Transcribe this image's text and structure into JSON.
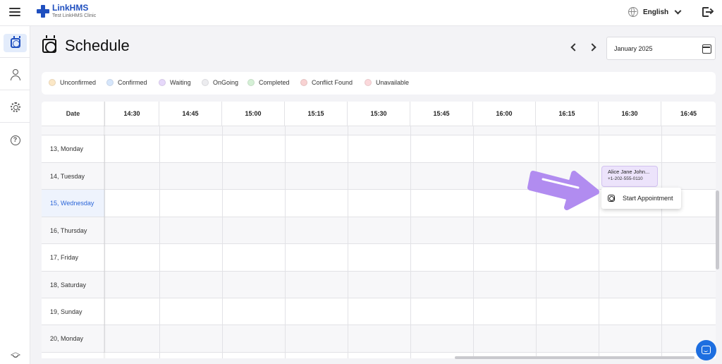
{
  "app": {
    "brand": "LinkHMS",
    "clinic": "Test LinkHMS Clinic",
    "language": "English"
  },
  "sidebar": {
    "items": [
      {
        "name": "sidebar-item-schedule",
        "icon": "schedule-icon",
        "active": true
      },
      {
        "name": "sidebar-item-patients",
        "icon": "user-icon",
        "active": false
      },
      {
        "name": "sidebar-item-settings",
        "icon": "gear-icon",
        "active": false
      },
      {
        "name": "sidebar-item-help",
        "icon": "help-icon",
        "active": false
      },
      {
        "name": "sidebar-item-learning",
        "icon": "graduation-cap-icon",
        "active": false
      }
    ]
  },
  "header": {
    "title": "Schedule",
    "date_value": "January 2025"
  },
  "legend": [
    {
      "label": "Unconfirmed",
      "color": "#fbe7c6"
    },
    {
      "label": "Confirmed",
      "color": "#d6e6fb"
    },
    {
      "label": "Waiting",
      "color": "#e6d8fa"
    },
    {
      "label": "OnGoing",
      "color": "#ececef"
    },
    {
      "label": "Completed",
      "color": "#d5f0d6"
    },
    {
      "label": "Conflict Found",
      "color": "#f8d2d2"
    },
    {
      "label": "Unavailable",
      "color": "#fbd8db"
    }
  ],
  "grid": {
    "date_header": "Date",
    "times": [
      "14:30",
      "14:45",
      "15:00",
      "15:15",
      "15:30",
      "15:45",
      "16:00",
      "16:15",
      "16:30",
      "16:45"
    ],
    "rows": [
      "13, Monday",
      "14, Tuesday",
      "15, Wednesday",
      "16, Thursday",
      "17, Friday",
      "18, Saturday",
      "19, Sunday",
      "20, Monday"
    ],
    "today_row": "15, Wednesday"
  },
  "appointment": {
    "name": "Alice Jane John...",
    "phone": "+1-202-555-0110",
    "status_color": "#ece3fb"
  },
  "context_menu": {
    "label": "Start Appointment"
  },
  "accent_color": "#1f4fbf",
  "annotation_color": "#b18cf0"
}
